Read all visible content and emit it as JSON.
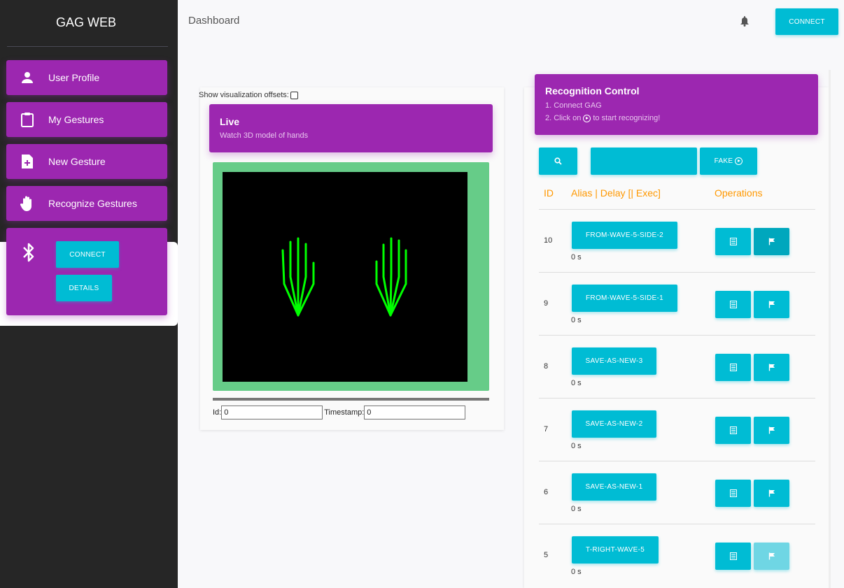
{
  "sidebar": {
    "brand": "GAG WEB",
    "items": [
      {
        "label": "User Profile",
        "icon": "person-icon"
      },
      {
        "label": "My Gestures",
        "icon": "clipboard-icon"
      },
      {
        "label": "New Gesture",
        "icon": "file-plus-icon"
      },
      {
        "label": "Recognize Gestures",
        "icon": "hand-icon"
      }
    ],
    "bluetooth": {
      "icon": "bluetooth-icon",
      "connect_label": "CONNECT",
      "details_label": "DETAILS"
    }
  },
  "header": {
    "title": "Dashboard",
    "connect_label": "CONNECT",
    "bell_icon": "bell-icon"
  },
  "live": {
    "show_offsets_label": "Show visualization offsets:",
    "show_offsets_checked": false,
    "title": "Live",
    "subtitle": "Watch 3D model of hands",
    "id_label": "Id:",
    "id_value": "0",
    "timestamp_label": "Timestamp:",
    "timestamp_value": "0"
  },
  "recognition": {
    "title": "Recognition Control",
    "step1": "1. Connect GAG",
    "step2_prefix": "2. Click on",
    "step2_suffix": "to start recognizing!",
    "fake_label": "FAKE",
    "columns": {
      "id": "ID",
      "alias": "Alias | Delay [| Exec]",
      "operations": "Operations"
    },
    "rows": [
      {
        "id": "10",
        "alias": "FROM-WAVE-5-SIDE-2",
        "delay": "0 s"
      },
      {
        "id": "9",
        "alias": "FROM-WAVE-5-SIDE-1",
        "delay": "0 s"
      },
      {
        "id": "8",
        "alias": "SAVE-AS-NEW-3",
        "delay": "0 s"
      },
      {
        "id": "7",
        "alias": "SAVE-AS-NEW-2",
        "delay": "0 s"
      },
      {
        "id": "6",
        "alias": "SAVE-AS-NEW-1",
        "delay": "0 s"
      },
      {
        "id": "5",
        "alias": "T-RIGHT-WAVE-5",
        "delay": "0 s"
      }
    ]
  },
  "colors": {
    "purple": "#9c27b0",
    "cyan": "#00bcd4",
    "orange": "#ff9800",
    "hand_green": "#00ff00"
  }
}
